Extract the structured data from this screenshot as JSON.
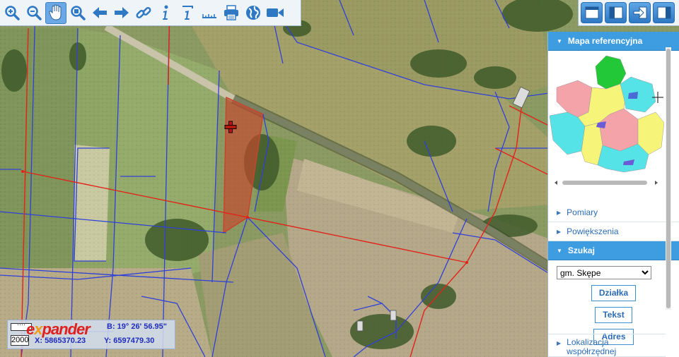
{
  "toolbar": {
    "tools": [
      {
        "name": "zoom-in-icon",
        "active": false
      },
      {
        "name": "zoom-out-icon",
        "active": false
      },
      {
        "name": "pan-hand-icon",
        "active": true
      },
      {
        "name": "zoom-area-icon",
        "active": false
      },
      {
        "name": "back-arrow-icon",
        "active": false
      },
      {
        "name": "forward-arrow-icon",
        "active": false
      },
      {
        "name": "link-icon",
        "active": false
      },
      {
        "name": "info-icon",
        "active": false
      },
      {
        "name": "info-edit-icon",
        "active": false
      },
      {
        "name": "measure-ruler-icon",
        "active": false
      },
      {
        "name": "print-icon",
        "active": false
      },
      {
        "name": "globe-icon",
        "active": false
      },
      {
        "name": "video-camera-icon",
        "active": false
      }
    ]
  },
  "viewbar": {
    "buttons": [
      "layout-full-icon",
      "layout-left-panel-icon",
      "layout-export-icon",
      "layout-right-panel-icon"
    ]
  },
  "panel": {
    "ref_title": "Mapa referencyjna",
    "items": {
      "pomiary": "Pomiary",
      "powiekszenia": "Powiększenia",
      "szukaj": "Szukaj",
      "lokalizacja": "Lokalizacja współrzędnej"
    },
    "search": {
      "selected": "gm. Skępe",
      "buttons": {
        "dzialka": "Działka",
        "tekst": "Tekst",
        "adres": "Adres"
      }
    }
  },
  "coords": {
    "lat_label": "B:",
    "lat": "19° 26' 56.95\"",
    "x_label": "X:",
    "x": "5865370.23",
    "y_label": "Y:",
    "y": "6597479.30",
    "scale": "2000",
    "logo": "expander"
  },
  "colors": {
    "accent": "#3d9de0",
    "parcel_line": "#2f3fd0",
    "boundary_red": "#e2231a",
    "selected_parcel": "#c8452c"
  }
}
